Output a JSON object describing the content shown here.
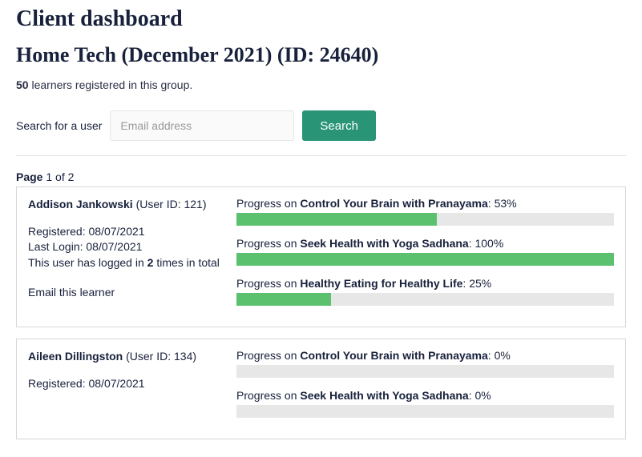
{
  "header": {
    "page_title": "Client dashboard",
    "group_title": "Home Tech (December 2021) (ID: 24640)",
    "learner_count_num": "50",
    "learner_count_text": " learners registered in this group."
  },
  "search": {
    "label": "Search for a user",
    "placeholder": "Email address",
    "button": "Search"
  },
  "pagination": {
    "prefix": "Page",
    "current": " 1 of 2"
  },
  "labels": {
    "user_id_prefix": "(User ID: ",
    "user_id_suffix": ")",
    "registered_prefix": "Registered: ",
    "lastlogin_prefix": "Last Login: ",
    "login_count_prefix": "This user has logged in ",
    "login_count_suffix": " times in total",
    "email_link": "Email this learner",
    "progress_prefix": "Progress on ",
    "progress_sep": ": ",
    "progress_pct_suffix": "%"
  },
  "users": [
    {
      "name": "Addison Jankowski",
      "user_id": "121",
      "registered": "08/07/2021",
      "last_login": "08/07/2021",
      "login_count": "2",
      "courses": [
        {
          "title": "Control Your Brain with Pranayama",
          "pct": 53
        },
        {
          "title": "Seek Health with Yoga Sadhana",
          "pct": 100
        },
        {
          "title": "Healthy Eating for Healthy Life",
          "pct": 25
        }
      ]
    },
    {
      "name": "Aileen Dillingston",
      "user_id": "134",
      "registered": "08/07/2021",
      "last_login": "",
      "login_count": "",
      "courses": [
        {
          "title": "Control Your Brain with Pranayama",
          "pct": 0
        },
        {
          "title": "Seek Health with Yoga Sadhana",
          "pct": 0
        }
      ]
    }
  ]
}
